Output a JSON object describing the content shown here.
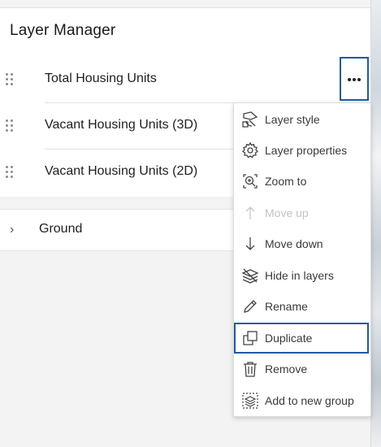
{
  "panel": {
    "title": "Layer Manager"
  },
  "layers": [
    {
      "label": "Total Housing Units"
    },
    {
      "label": "Vacant Housing Units (3D)"
    },
    {
      "label": "Vacant Housing Units (2D)"
    }
  ],
  "ground": {
    "label": "Ground",
    "chevron": "›"
  },
  "more_button": {
    "icon": "more-horizontal-icon"
  },
  "menu": {
    "items": [
      {
        "label": "Layer style",
        "icon": "layer-style-icon",
        "enabled": true
      },
      {
        "label": "Layer properties",
        "icon": "gear-icon",
        "enabled": true
      },
      {
        "label": "Zoom to",
        "icon": "zoom-to-icon",
        "enabled": true
      },
      {
        "label": "Move up",
        "icon": "arrow-up-icon",
        "enabled": false
      },
      {
        "label": "Move down",
        "icon": "arrow-down-icon",
        "enabled": true
      },
      {
        "label": "Hide in layers",
        "icon": "hide-layers-icon",
        "enabled": true
      },
      {
        "label": "Rename",
        "icon": "pencil-icon",
        "enabled": true
      },
      {
        "label": "Duplicate",
        "icon": "duplicate-icon",
        "enabled": true,
        "focused": true
      },
      {
        "label": "Remove",
        "icon": "trash-icon",
        "enabled": true
      },
      {
        "label": "Add to new group",
        "icon": "add-group-icon",
        "enabled": true
      }
    ]
  },
  "colors": {
    "focus_outline": "#1f5aa0",
    "disabled_text": "#c3c3c3"
  }
}
